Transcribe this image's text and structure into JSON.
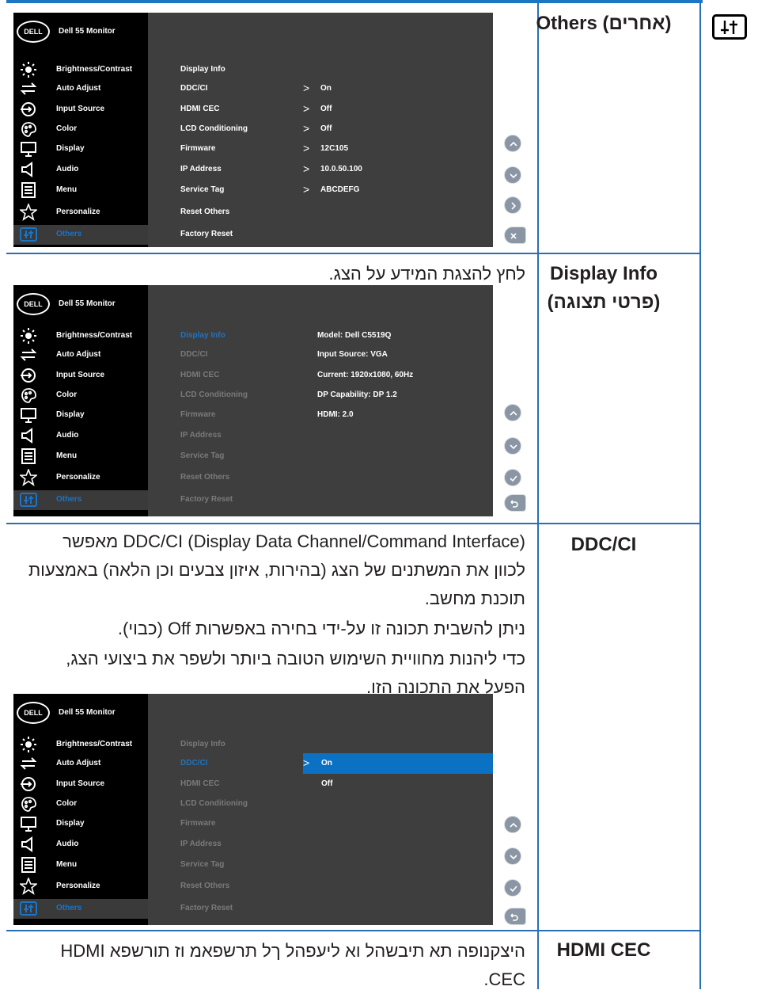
{
  "header_icon": "others-sliders-icon",
  "osd_brand": "DELL",
  "osd_title": "Dell 55 Monitor",
  "osd_menu": [
    "Brightness/Contrast",
    "Auto Adjust",
    "Input Source",
    "Color",
    "Display",
    "Audio",
    "Menu",
    "Personalize",
    "Others"
  ],
  "osd_menu_icons": [
    "brightness-icon",
    "auto-adjust-icon",
    "input-source-icon",
    "color-icon",
    "display-icon",
    "audio-icon",
    "menu-icon",
    "personalize-icon",
    "others-icon"
  ],
  "osd_sub": [
    "Display Info",
    "DDC/CI",
    "HDMI CEC",
    "LCD Conditioning",
    "Firmware",
    "IP Address",
    "Service Tag",
    "Reset Others",
    "Factory Reset"
  ],
  "osd_values": {
    "ddcci": "On",
    "hdmicec": "Off",
    "lcd": "Off",
    "firmware": "12C105",
    "ip": "10.0.50.100",
    "tag": "ABCDEFG"
  },
  "osd_info": [
    "Model: Dell C5519Q",
    "Input Source: VGA",
    "Current: 1920x1080, 60Hz",
    "DP Capability: DP 1.2",
    "HDMI: 2.0"
  ],
  "osd_ddc_options": [
    "On",
    "Off"
  ],
  "rows": {
    "others": {
      "label": "Others (אחרים)"
    },
    "display_info": {
      "label": "Display Info",
      "label2": "(פרטי תצוגה)",
      "desc": "לחץ להצגת המידע על הצג."
    },
    "ddcci": {
      "label": "DDC/CI",
      "p1": "(Display Data Channel/Command Interface) DDC/CI מאפשר לכוון את המשתנים של הצג (בהירות, איזון צבעים וכן הלאה) באמצעות תוכנת מחשב.",
      "p2": "ניתן להשבית תכונה זו על-ידי בחירה באפשרות Off (כבוי).",
      "p3": "כדי ליהנות מחוויית השימוש הטובה ביותר ולשפר את ביצועי הצג, הפעל את התכונה הזו."
    },
    "hdmicec": {
      "label": "HDMI CEC",
      "desc": "היצקנופה תא תיבשהל וא ליעפהל ךל תרשפאמ וז תורשפא HDMI CEC."
    }
  },
  "colors": {
    "rule": "#2a6fb5",
    "osd_bg": "#3e3e3e",
    "osd_side": "#000000",
    "highlight": "#0b72c3",
    "selected_text": "#1c74c4"
  }
}
